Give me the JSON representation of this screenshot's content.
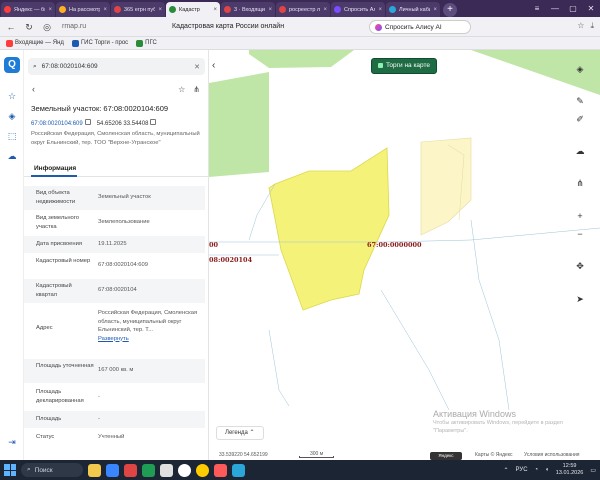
{
  "browser": {
    "tabs": [
      {
        "label": "Яндекс — быстр",
        "color": "#ff3d3d"
      },
      {
        "label": "На рассмотр",
        "color": "#ffb020"
      },
      {
        "label": "365 егрн публ",
        "color": "#e04545"
      },
      {
        "label": "Кадастр",
        "color": "#2a8c3a",
        "active": true
      },
      {
        "label": "3 · Входящие",
        "color": "#e04545"
      },
      {
        "label": "росреестр лич",
        "color": "#e04545"
      },
      {
        "label": "Спросить Алису",
        "color": "#7b4dff"
      },
      {
        "label": "Личный кабин",
        "color": "#2aa6d9"
      }
    ],
    "url": "rmap.ru",
    "page_title": "Кадастровая карта России онлайн",
    "alisa_label": "Спросить Алису AI",
    "bookmarks": [
      {
        "label": "Входящие — Янд",
        "color": "#ff3d3d"
      },
      {
        "label": "ГИС Торги - прос",
        "color": "#1e5bb0"
      },
      {
        "label": "ПГС",
        "color": "#2a8c3a"
      }
    ]
  },
  "panel": {
    "search_value": "67:08:0020104:609",
    "title": "Земельный участок: 67:08:0020104:609",
    "cad_number": "67:08:0020104:609",
    "coords": "54.65206 33.54408",
    "address_short": "Российская Федерация, Смоленская область, муниципальный округ Ельнинский, тер. ТОО \"Верхне-Угранское\"",
    "tab_info": "Информация",
    "rows": [
      {
        "k": "Вид объекта недвижимости",
        "v": "Земельный участок"
      },
      {
        "k": "Вид земельного участка",
        "v": "Землепользование"
      },
      {
        "k": "Дата присвоения",
        "v": "19.11.2025"
      },
      {
        "k": "Кадастровый номер",
        "v": "67:08:0020104:609"
      },
      {
        "k": "Кадастровый квартал",
        "v": "67:08:0020104"
      },
      {
        "k": "Адрес",
        "v": "Российская Федерация, Смоленская область, муниципальный округ Ельнинский, тер. Т...",
        "link": "Развернуть"
      },
      {
        "k": "Площадь уточненная",
        "v": "167 000 кв. м"
      },
      {
        "k": "Площадь декларированная",
        "v": "-"
      },
      {
        "k": "Площадь",
        "v": "-"
      },
      {
        "k": "Статус",
        "v": "Учтенный"
      }
    ]
  },
  "map": {
    "torgi_label": "Торги на карте",
    "label_kvartal": "67:00:0000000",
    "label_left": "08:0020104",
    "label_edge": "00",
    "legend_label": "Легенда",
    "coords_readout": "33.539220  54.652199",
    "scale_label": "300 м",
    "yandex_button": "Яндекс Браузер",
    "copyright": "Карты © Яндекс",
    "terms": "Условия использования"
  },
  "watermark": {
    "title": "Активация Windows",
    "text": "Чтобы активировать Windows, перейдите в раздел \"Параметры\"."
  },
  "taskbar": {
    "search_label": "Поиск",
    "lang": "РУС",
    "time": "12:59",
    "date": "13.01.2026"
  },
  "colors": {
    "green_polygon": "#bfe6a6",
    "yellow_polygon": "#f5f27a",
    "light_yellow_polygon": "#fbf5c8",
    "label_red": "#8b1a1a",
    "torgi_button": "#1e6b44"
  }
}
